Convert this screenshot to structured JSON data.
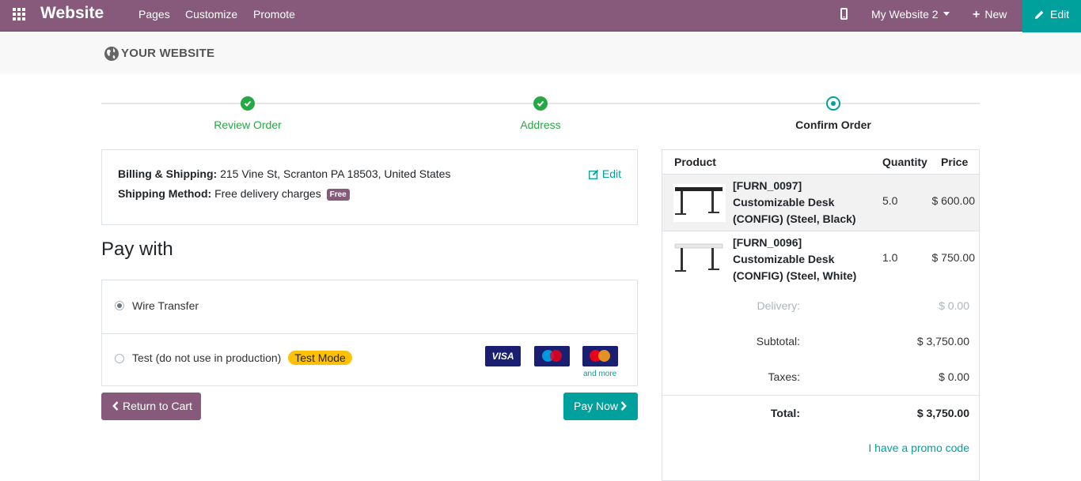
{
  "topbar": {
    "brand": "Website",
    "nav": [
      "Pages",
      "Customize",
      "Promote"
    ],
    "site_selector": "My Website 2",
    "new_label": "New",
    "edit_label": "Edit",
    "colors": {
      "bar": "#875a7b",
      "edit": "#00a09d"
    }
  },
  "site_header": {
    "logo_text": "YOUR WEBSITE"
  },
  "wizard": {
    "steps": [
      {
        "label": "Review Order",
        "state": "done"
      },
      {
        "label": "Address",
        "state": "done"
      },
      {
        "label": "Confirm Order",
        "state": "current"
      }
    ]
  },
  "address": {
    "billing_label": "Billing & Shipping:",
    "billing_value": "215 Vine St, Scranton PA 18503, United States",
    "shipping_label": "Shipping Method:",
    "shipping_value": "Free delivery charges",
    "shipping_badge": "Free",
    "edit_label": "Edit"
  },
  "payment": {
    "title": "Pay with",
    "options": [
      {
        "label": "Wire Transfer",
        "selected": true
      },
      {
        "label": "Test (do not use in production)",
        "badge": "Test Mode",
        "selected": false
      }
    ],
    "card_logos": [
      "VISA",
      "Maestro",
      "MasterCard"
    ],
    "and_more": "and more"
  },
  "buttons": {
    "return_label": "Return to Cart",
    "pay_label": "Pay Now"
  },
  "summary": {
    "headers": {
      "product": "Product",
      "quantity": "Quantity",
      "price": "Price"
    },
    "items": [
      {
        "name": "[FURN_0097] Customizable Desk (CONFIG) (Steel, Black)",
        "qty": "5.0",
        "price": "$ 600.00"
      },
      {
        "name": "[FURN_0096] Customizable Desk (CONFIG) (Steel, White)",
        "qty": "1.0",
        "price": "$ 750.00"
      }
    ],
    "delivery_label": "Delivery:",
    "delivery_value": "$ 0.00",
    "subtotal_label": "Subtotal:",
    "subtotal_value": "$ 3,750.00",
    "taxes_label": "Taxes:",
    "taxes_value": "$ 0.00",
    "total_label": "Total:",
    "total_value": "$ 3,750.00",
    "promo_label": "I have a promo code"
  }
}
